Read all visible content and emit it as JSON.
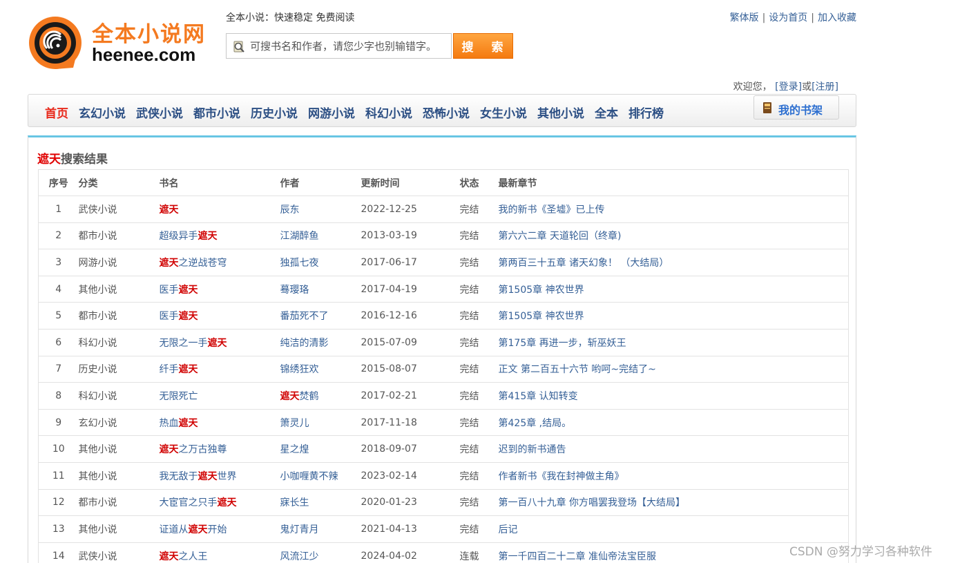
{
  "header": {
    "logo_title": "全本小说网",
    "logo_domain": "heenee.com",
    "slogan": "全本小说：快速稳定 免费阅读",
    "search_placeholder": "可搜书名和作者，请您少字也别输错字。",
    "search_button": "搜 索",
    "links": [
      "繁体版",
      "设为首页",
      "加入收藏"
    ],
    "link_separator": "|"
  },
  "welcome": {
    "text": "欢迎您，",
    "login": "[登录]",
    "or": "或",
    "register": "[注册]"
  },
  "nav": {
    "items": [
      "首页",
      "玄幻小说",
      "武侠小说",
      "都市小说",
      "历史小说",
      "网游小说",
      "科幻小说",
      "恐怖小说",
      "女生小说",
      "其他小说",
      "全本",
      "排行榜"
    ],
    "active_index": 0,
    "bookshelf": "我的书架"
  },
  "results": {
    "keyword": "遮天",
    "title_suffix": "搜索结果",
    "columns": [
      "序号",
      "分类",
      "书名",
      "作者",
      "更新时间",
      "状态",
      "最新章节"
    ],
    "rows": [
      {
        "no": "1",
        "category": "武侠小说",
        "title": [
          "",
          "遮天",
          ""
        ],
        "author": [
          "辰东",
          "",
          ""
        ],
        "date": "2022-12-25",
        "status": "完结",
        "latest": "我的新书《圣墟》已上传"
      },
      {
        "no": "2",
        "category": "都市小说",
        "title": [
          "超级异手",
          "遮天",
          ""
        ],
        "author": [
          "江湖醉鱼",
          "",
          ""
        ],
        "date": "2013-03-19",
        "status": "完结",
        "latest": "第六六二章 天道轮回（终章)"
      },
      {
        "no": "3",
        "category": "网游小说",
        "title": [
          "",
          "遮天",
          "之逆战苍穹"
        ],
        "author": [
          "独孤七夜",
          "",
          ""
        ],
        "date": "2017-06-17",
        "status": "完结",
        "latest": "第两百三十五章 诸天幻象！ （大结局）"
      },
      {
        "no": "4",
        "category": "其他小说",
        "title": [
          "医手",
          "遮天",
          ""
        ],
        "author": [
          "蓦璎珞",
          "",
          ""
        ],
        "date": "2017-04-19",
        "status": "完结",
        "latest": "第1505章 神农世界"
      },
      {
        "no": "5",
        "category": "都市小说",
        "title": [
          "医手",
          "遮天",
          ""
        ],
        "author": [
          "番茄死不了",
          "",
          ""
        ],
        "date": "2016-12-16",
        "status": "完结",
        "latest": "第1505章 神农世界"
      },
      {
        "no": "6",
        "category": "科幻小说",
        "title": [
          "无限之一手",
          "遮天",
          ""
        ],
        "author": [
          "纯洁的清影",
          "",
          ""
        ],
        "date": "2015-07-09",
        "status": "完结",
        "latest": "第175章 再进一步，斩巫妖王"
      },
      {
        "no": "7",
        "category": "历史小说",
        "title": [
          "纤手",
          "遮天",
          ""
        ],
        "author": [
          "锦绣狂欢",
          "",
          ""
        ],
        "date": "2015-08-07",
        "status": "完结",
        "latest": "正文 第二百五十六节 哟呵~完结了~"
      },
      {
        "no": "8",
        "category": "科幻小说",
        "title": [
          "无限死亡",
          "",
          ""
        ],
        "author": [
          "",
          "遮天",
          "焚鹤"
        ],
        "date": "2017-02-21",
        "status": "完结",
        "latest": "第415章 认知转变"
      },
      {
        "no": "9",
        "category": "玄幻小说",
        "title": [
          "热血",
          "遮天",
          ""
        ],
        "author": [
          "箫灵儿",
          "",
          ""
        ],
        "date": "2017-11-18",
        "status": "完结",
        "latest": "第425章 ,结局。"
      },
      {
        "no": "10",
        "category": "其他小说",
        "title": [
          "",
          "遮天",
          "之万古独尊"
        ],
        "author": [
          "星之煌",
          "",
          ""
        ],
        "date": "2018-09-07",
        "status": "完结",
        "latest": "迟到的新书通告"
      },
      {
        "no": "11",
        "category": "其他小说",
        "title": [
          "我无敌于",
          "遮天",
          "世界"
        ],
        "author": [
          "小咖喱黄不辣",
          "",
          ""
        ],
        "date": "2023-02-14",
        "status": "完结",
        "latest": "作者新书《我在封神做主角》"
      },
      {
        "no": "12",
        "category": "都市小说",
        "title": [
          "大宦官之只手",
          "遮天",
          ""
        ],
        "author": [
          "寐长生",
          "",
          ""
        ],
        "date": "2020-01-23",
        "status": "完结",
        "latest": "第一百八十九章 你方唱罢我登场【大结局】"
      },
      {
        "no": "13",
        "category": "其他小说",
        "title": [
          "证道从",
          "遮天",
          "开始"
        ],
        "author": [
          "鬼灯青月",
          "",
          ""
        ],
        "date": "2021-04-13",
        "status": "完结",
        "latest": "后记"
      },
      {
        "no": "14",
        "category": "武侠小说",
        "title": [
          "",
          "遮天",
          "之人王"
        ],
        "author": [
          "风流江少",
          "",
          ""
        ],
        "date": "2024-04-02",
        "status": "连载",
        "latest": "第一千四百二十二章 准仙帝法宝臣服"
      }
    ]
  },
  "watermark": "CSDN @努力学习各种软件",
  "colors": {
    "brand_orange": "#f47a20",
    "nav_blue": "#2c4f84",
    "active_red": "#e8291b",
    "highlight_red": "#d00000",
    "link_blue": "#345f96",
    "panel_accent": "#68c6e4"
  }
}
